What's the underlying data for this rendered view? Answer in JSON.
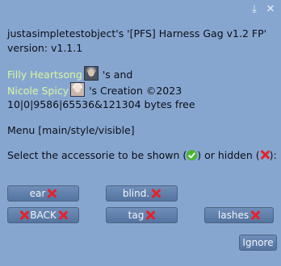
{
  "titlebar": {
    "icons": [
      "download-icon",
      "close-icon"
    ]
  },
  "message": {
    "line1": "justasimpletestobject's '[PFS] Harness Gag v1.2 FP'",
    "line2": "version: v1.1.1",
    "creator1": "Filly Heartsong",
    "creator1_suffix": " 's and",
    "creator2": "Nicole Spicy",
    "creator2_suffix": " 's Creation ©2023",
    "memory": "10|0|9586|65536&121304 bytes free",
    "menu": "Menu [main/style/visible]",
    "prompt_before": "Select the accessorie to be shown (",
    "prompt_middle": ") or hidden (",
    "prompt_after": "):"
  },
  "buttons": {
    "ear": "ear",
    "blind": "blind.",
    "back": "BACK",
    "tag": "tag",
    "lashes": "lashes",
    "ignore": "Ignore"
  },
  "colors": {
    "background": "#87a6cf",
    "link": "#d8f7a1",
    "hidden_mark": "#e4222c",
    "shown_mark": "#47b52f"
  }
}
